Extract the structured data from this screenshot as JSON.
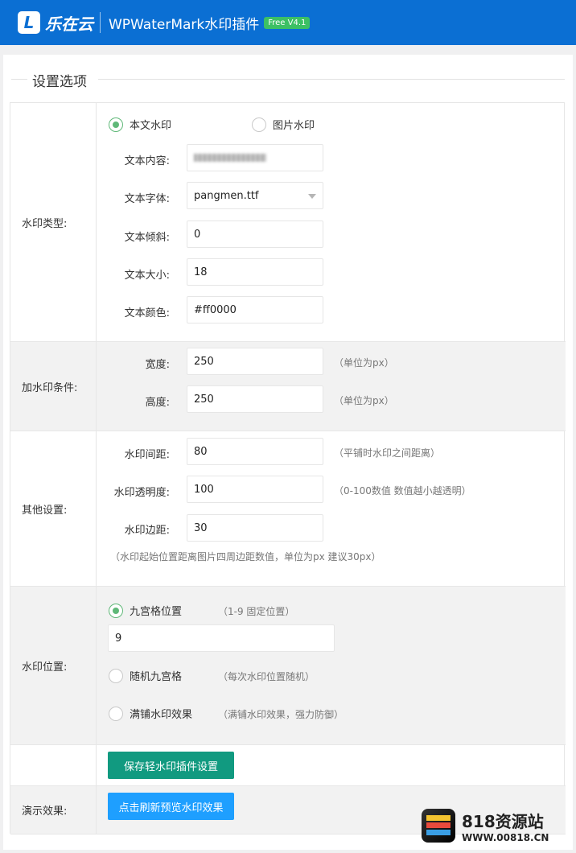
{
  "header": {
    "logo_letter": "L",
    "brand": "乐在云",
    "title": "WPWaterMark水印插件",
    "badge": "Free V4.1"
  },
  "section_title": "设置选项",
  "watermark_type": {
    "label": "水印类型:",
    "radio_text": "本文水印",
    "radio_image": "图片水印",
    "fields": {
      "content_label": "文本内容:",
      "font_label": "文本字体:",
      "font_value": "pangmen.ttf",
      "tilt_label": "文本倾斜:",
      "tilt_value": "0",
      "size_label": "文本大小:",
      "size_value": "18",
      "color_label": "文本颜色:",
      "color_value": "#ff0000"
    }
  },
  "conditions": {
    "label": "加水印条件:",
    "width_label": "宽度:",
    "width_value": "250",
    "width_hint": "（单位为px）",
    "height_label": "高度:",
    "height_value": "250",
    "height_hint": "（单位为px）"
  },
  "other": {
    "label": "其他设置:",
    "spacing_label": "水印间距:",
    "spacing_value": "80",
    "spacing_hint": "（平铺时水印之间距离）",
    "opacity_label": "水印透明度:",
    "opacity_value": "100",
    "opacity_hint": "（0-100数值 数值越小越透明）",
    "margin_label": "水印边距:",
    "margin_value": "30",
    "margin_hint": "（水印起始位置距离图片四周边距数值，单位为px 建议30px）"
  },
  "position": {
    "label": "水印位置:",
    "grid_label": "九宫格位置",
    "grid_hint": "（1-9 固定位置）",
    "grid_value": "9",
    "random_label": "随机九宫格",
    "random_hint": "（每次水印位置随机）",
    "tile_label": "满铺水印效果",
    "tile_hint": "（满铺水印效果，强力防御）"
  },
  "save_button": "保存轻水印插件设置",
  "demo": {
    "label": "演示效果:",
    "button": "点击刷新预览水印效果"
  },
  "site_watermark": {
    "name": "818资源站",
    "url": "WWW.00818.CN"
  },
  "colors": {
    "header_blue": "#0b6fd3",
    "badge_green": "#3cc064",
    "save_green": "#119a80",
    "preview_blue": "#1e9fff",
    "radio_green": "#5fb878"
  }
}
